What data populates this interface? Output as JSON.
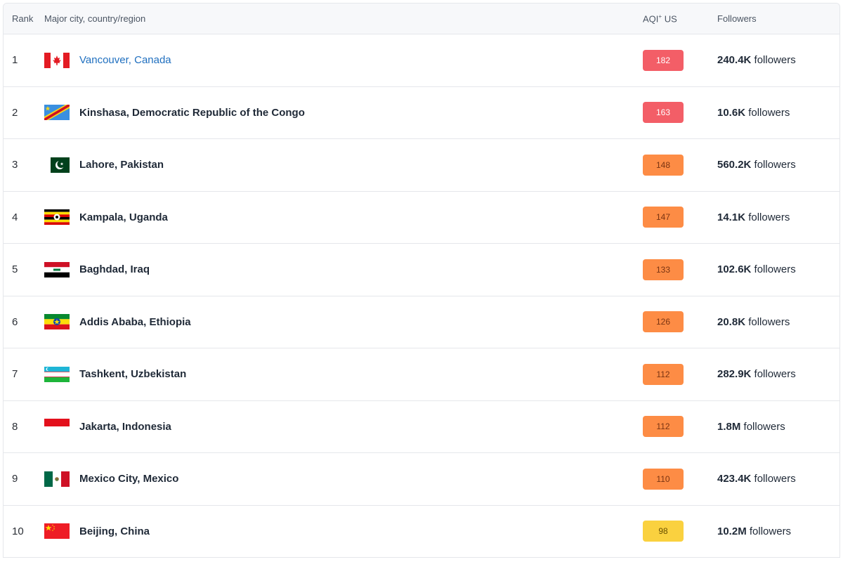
{
  "header": {
    "rank": "Rank",
    "city": "Major city, country/region",
    "aqi": "AQI",
    "aqi_sup": "+",
    "aqi_suffix": " US",
    "followers": "Followers"
  },
  "rows": [
    {
      "rank": "1",
      "city": "Vancouver, Canada",
      "flag": "canada-flag-icon",
      "aqi": "182",
      "aqi_level": "red",
      "followers_count": "240.4K",
      "followers_suffix": " followers"
    },
    {
      "rank": "2",
      "city": "Kinshasa, Democratic Republic of the Congo",
      "flag": "congo-flag-icon",
      "aqi": "163",
      "aqi_level": "red",
      "followers_count": "10.6K",
      "followers_suffix": " followers"
    },
    {
      "rank": "3",
      "city": "Lahore, Pakistan",
      "flag": "pakistan-flag-icon",
      "aqi": "148",
      "aqi_level": "orange",
      "followers_count": "560.2K",
      "followers_suffix": " followers"
    },
    {
      "rank": "4",
      "city": "Kampala, Uganda",
      "flag": "uganda-flag-icon",
      "aqi": "147",
      "aqi_level": "orange",
      "followers_count": "14.1K",
      "followers_suffix": " followers"
    },
    {
      "rank": "5",
      "city": "Baghdad, Iraq",
      "flag": "iraq-flag-icon",
      "aqi": "133",
      "aqi_level": "orange",
      "followers_count": "102.6K",
      "followers_suffix": " followers"
    },
    {
      "rank": "6",
      "city": "Addis Ababa, Ethiopia",
      "flag": "ethiopia-flag-icon",
      "aqi": "126",
      "aqi_level": "orange",
      "followers_count": "20.8K",
      "followers_suffix": " followers"
    },
    {
      "rank": "7",
      "city": "Tashkent, Uzbekistan",
      "flag": "uzbekistan-flag-icon",
      "aqi": "112",
      "aqi_level": "orange",
      "followers_count": "282.9K",
      "followers_suffix": " followers"
    },
    {
      "rank": "8",
      "city": "Jakarta, Indonesia",
      "flag": "indonesia-flag-icon",
      "aqi": "112",
      "aqi_level": "orange",
      "followers_count": "1.8M",
      "followers_suffix": " followers"
    },
    {
      "rank": "9",
      "city": "Mexico City, Mexico",
      "flag": "mexico-flag-icon",
      "aqi": "110",
      "aqi_level": "orange",
      "followers_count": "423.4K",
      "followers_suffix": " followers"
    },
    {
      "rank": "10",
      "city": "Beijing, China",
      "flag": "china-flag-icon",
      "aqi": "98",
      "aqi_level": "yellow",
      "followers_count": "10.2M",
      "followers_suffix": " followers"
    }
  ],
  "colors": {
    "aqi_red": "#f35e67",
    "aqi_orange": "#fd8c45",
    "aqi_yellow": "#fad13f",
    "link": "#1f6fbf"
  }
}
